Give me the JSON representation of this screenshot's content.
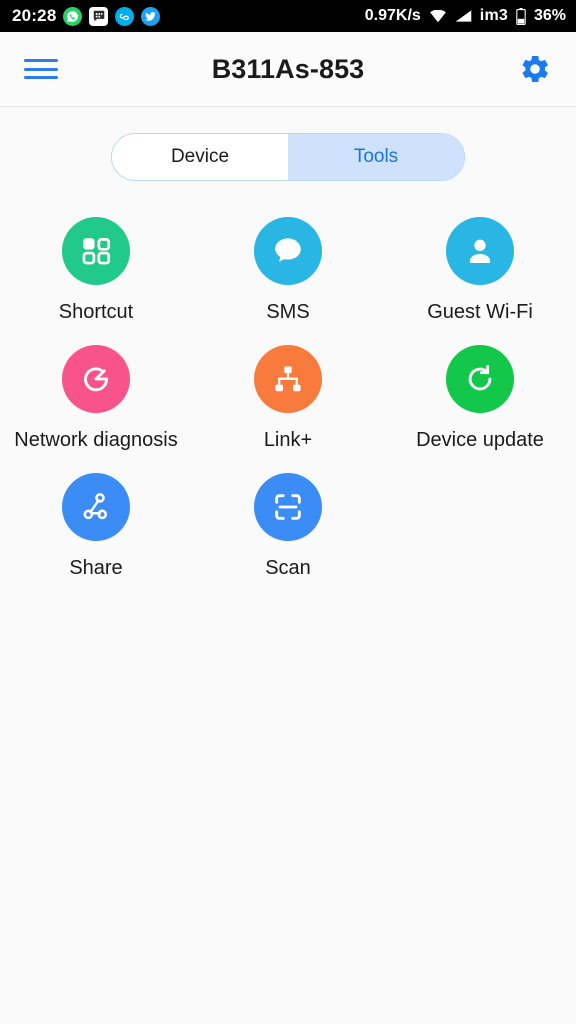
{
  "status_bar": {
    "time": "20:28",
    "notification_icons": [
      {
        "name": "whatsapp-icon",
        "glyph": "✆"
      },
      {
        "name": "bbm-icon",
        "glyph": "⌨"
      },
      {
        "name": "loop-icon",
        "glyph": "∞"
      },
      {
        "name": "twitter-icon",
        "glyph": "✓"
      }
    ],
    "network_speed": "0.97K/s",
    "wifi_icon": "wifi-icon",
    "signal_icon": "signal-icon",
    "carrier": "im3",
    "battery_icon": "battery-icon",
    "battery_percent": "36%"
  },
  "header": {
    "menu_icon": "hamburger-menu-icon",
    "title": "B311As-853",
    "settings_icon": "gear-icon"
  },
  "tabs": {
    "items": [
      {
        "label": "Device",
        "active": false
      },
      {
        "label": "Tools",
        "active": true
      }
    ],
    "active_color": "#1a73e8",
    "active_bg": "#cfe2fd",
    "border_color": "#b9d6fb"
  },
  "tools": {
    "items": [
      {
        "label": "Shortcut",
        "icon": "grid-squares-icon",
        "color": "#21c98a"
      },
      {
        "label": "SMS",
        "icon": "speech-bubble-icon",
        "color": "#2ab6e4"
      },
      {
        "label": "Guest Wi-Fi",
        "icon": "person-icon",
        "color": "#2ab6e4"
      },
      {
        "label": "Network diagnosis",
        "icon": "gauge-meter-icon",
        "color": "#f9538c"
      },
      {
        "label": "Link+",
        "icon": "network-topology-icon",
        "color": "#f97a3d"
      },
      {
        "label": "Device update",
        "icon": "refresh-circle-icon",
        "color": "#13c74a"
      },
      {
        "label": "Share",
        "icon": "share-nodes-icon",
        "color": "#3b8cf5"
      },
      {
        "label": "Scan",
        "icon": "scan-frame-icon",
        "color": "#3b8cf5"
      }
    ]
  },
  "theme": {
    "page_background": "#fafafa",
    "accent": "#2b7bf3",
    "text": "#1b1b1b"
  }
}
